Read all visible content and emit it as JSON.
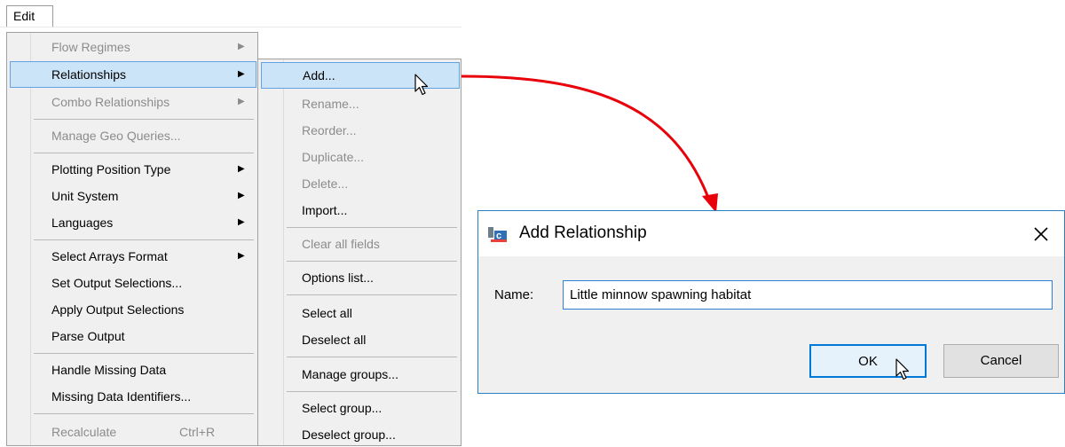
{
  "menubar": {
    "edit_label": "Edit"
  },
  "edit_menu": {
    "items": [
      {
        "label": "Flow Regimes",
        "enabled": false,
        "submenu": true
      },
      {
        "label": "Relationships",
        "enabled": true,
        "submenu": true,
        "highlighted": true
      },
      {
        "label": "Combo Relationships",
        "enabled": false,
        "submenu": true
      },
      {
        "label": "Manage Geo Queries...",
        "enabled": false
      },
      {
        "label": "Plotting Position Type",
        "enabled": true,
        "submenu": true
      },
      {
        "label": "Unit System",
        "enabled": true,
        "submenu": true
      },
      {
        "label": "Languages",
        "enabled": true,
        "submenu": true
      },
      {
        "label": "Select Arrays Format",
        "enabled": true,
        "submenu": true
      },
      {
        "label": "Set Output Selections...",
        "enabled": true
      },
      {
        "label": "Apply Output Selections",
        "enabled": true
      },
      {
        "label": "Parse Output",
        "enabled": true
      },
      {
        "label": "Handle Missing Data",
        "enabled": true
      },
      {
        "label": "Missing Data Identifiers...",
        "enabled": true
      },
      {
        "label": "Recalculate",
        "enabled": false,
        "shortcut": "Ctrl+R"
      }
    ]
  },
  "relationships_submenu": {
    "items": [
      {
        "label": "Add...",
        "enabled": true,
        "highlighted": true
      },
      {
        "label": "Rename...",
        "enabled": false
      },
      {
        "label": "Reorder...",
        "enabled": false
      },
      {
        "label": "Duplicate...",
        "enabled": false
      },
      {
        "label": "Delete...",
        "enabled": false
      },
      {
        "label": "Import...",
        "enabled": true
      },
      {
        "label": "Clear all fields",
        "enabled": false
      },
      {
        "label": "Options list...",
        "enabled": true
      },
      {
        "label": "Select all",
        "enabled": true
      },
      {
        "label": "Deselect all",
        "enabled": true
      },
      {
        "label": "Manage groups...",
        "enabled": true
      },
      {
        "label": "Select group...",
        "enabled": true
      },
      {
        "label": "Deselect group...",
        "enabled": true
      }
    ]
  },
  "dialog": {
    "title": "Add Relationship",
    "name_label": "Name:",
    "name_value": "Little minnow spawning habitat",
    "ok_label": "OK",
    "cancel_label": "Cancel"
  },
  "colors": {
    "highlight_fill": "#cce4f7",
    "highlight_border": "#62a2e4",
    "connector_arrow": "#e8000b",
    "dialog_border": "#2b7fc3",
    "disabled_text": "#8c8c8c"
  }
}
